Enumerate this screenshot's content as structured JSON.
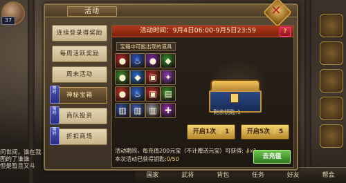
{
  "hud": {
    "level": "37",
    "left_chat": [
      "问世间，谁在我",
      "图的了谁谁",
      "但是暂且又斗"
    ],
    "right_labels": [
      "",
      "",
      "",
      "",
      "",
      "",
      ""
    ]
  },
  "bottom_bar": [
    "国家",
    "武将",
    "背包",
    "任务",
    "好友",
    "帮会"
  ],
  "panel": {
    "title": "活动",
    "close_symbol": "✕"
  },
  "tabs": [
    {
      "label": "连续登录得奖励",
      "active": false,
      "badge": ""
    },
    {
      "label": "每周活跃奖励",
      "active": false,
      "badge": ""
    },
    {
      "label": "周末活动",
      "active": false,
      "badge": ""
    },
    {
      "label": "神秘宝箱",
      "active": true,
      "badge": "限时"
    },
    {
      "label": "商队投资",
      "active": false,
      "badge": "限时"
    },
    {
      "label": "折扣商场",
      "active": false,
      "badge": "限时"
    }
  ],
  "content": {
    "time_text": "活动时间：9月4日06:00-9月5日23:59",
    "help": "?",
    "items_label": "宝箱中可能出现的道具",
    "keys_left": "剩余钥匙:1",
    "open_one_label": "开启1次",
    "open_one_cost": "1",
    "open_five_label": "开启5次",
    "open_five_cost": "5",
    "note_line1": "活动期间，每充值200元宝（不计赠送元宝）可获得:",
    "note_reward": "x1",
    "note_line2_prefix": "本次活动已获得钥匙:",
    "note_line2_value": "0/50",
    "recharge_label": "去充值"
  },
  "items": [
    {
      "icon": "red-bag",
      "color": "#b3262a",
      "glyph": "●"
    },
    {
      "icon": "blue-flame",
      "color": "#2a56c9",
      "glyph": "♨"
    },
    {
      "icon": "purple-bag",
      "color": "#7c2aa6",
      "glyph": "●"
    },
    {
      "icon": "green-gem",
      "color": "#2f8a2d",
      "glyph": "◆"
    },
    {
      "icon": "green-bag",
      "color": "#3e8c2b",
      "glyph": "●"
    },
    {
      "icon": "blue-crystal",
      "color": "#1f6fd6",
      "glyph": "◆"
    },
    {
      "icon": "red-gift",
      "color": "#b02a2a",
      "glyph": "▣"
    },
    {
      "icon": "purple-scroll",
      "color": "#8a3bb2",
      "glyph": "✦"
    },
    {
      "icon": "red-bag",
      "color": "#c43028",
      "glyph": "●"
    },
    {
      "icon": "blue-flame",
      "color": "#2a66d6",
      "glyph": "♨"
    },
    {
      "icon": "red-gift",
      "color": "#b72c2c",
      "glyph": "▣"
    },
    {
      "icon": "green-card",
      "color": "#3b8f2d",
      "glyph": "▤"
    },
    {
      "icon": "blue-book",
      "color": "#2a4fa8",
      "glyph": "▥"
    },
    {
      "icon": "blue-book",
      "color": "#3a5fb8",
      "glyph": "▥"
    },
    {
      "icon": "white-book",
      "color": "#8f8f9a",
      "glyph": "▥"
    },
    {
      "icon": "purple-potion",
      "color": "#8d2ab0",
      "glyph": "✚"
    }
  ]
}
